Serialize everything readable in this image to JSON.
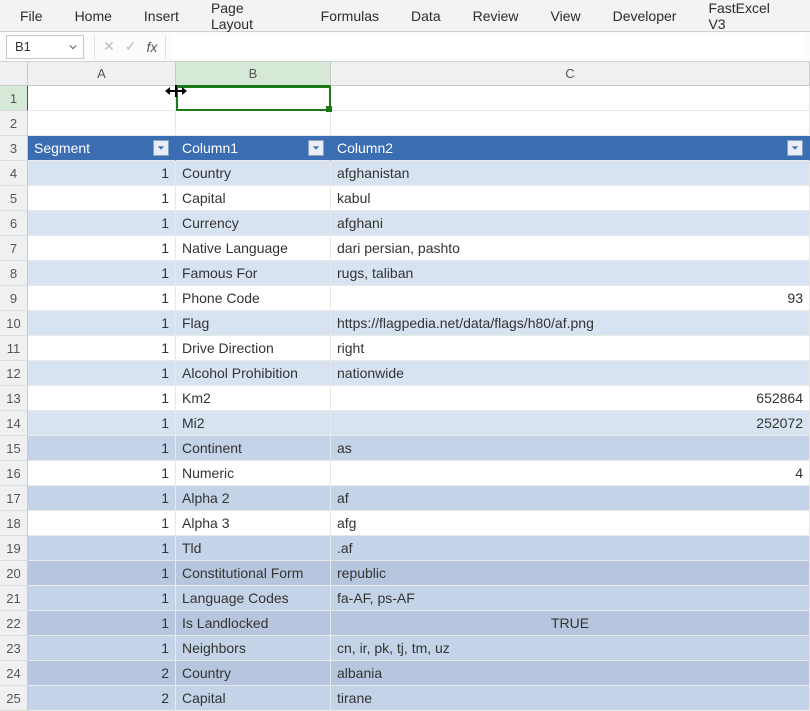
{
  "ribbon": {
    "tabs": [
      "File",
      "Home",
      "Insert",
      "Page Layout",
      "Formulas",
      "Data",
      "Review",
      "View",
      "Developer",
      "FastExcel V3"
    ]
  },
  "formula_bar": {
    "name_box": "B1",
    "cancel": "✕",
    "confirm": "✓",
    "fx": "fx",
    "value": ""
  },
  "columns": [
    "A",
    "B",
    "C"
  ],
  "active_cell": "B1",
  "table": {
    "headers": {
      "a": "Segment",
      "b": "Column1",
      "c": "Column2"
    },
    "rows": [
      {
        "a": "1",
        "b": "Country",
        "c": "afghanistan",
        "ca": "left"
      },
      {
        "a": "1",
        "b": "Capital",
        "c": "kabul",
        "ca": "left"
      },
      {
        "a": "1",
        "b": "Currency",
        "c": "afghani",
        "ca": "left"
      },
      {
        "a": "1",
        "b": "Native Language",
        "c": "dari persian, pashto",
        "ca": "left"
      },
      {
        "a": "1",
        "b": "Famous For",
        "c": "rugs, taliban",
        "ca": "left"
      },
      {
        "a": "1",
        "b": "Phone Code",
        "c": "93",
        "ca": "num"
      },
      {
        "a": "1",
        "b": "Flag",
        "c": "https://flagpedia.net/data/flags/h80/af.png",
        "ca": "left"
      },
      {
        "a": "1",
        "b": "Drive Direction",
        "c": "right",
        "ca": "left"
      },
      {
        "a": "1",
        "b": "Alcohol Prohibition",
        "c": "nationwide",
        "ca": "left"
      },
      {
        "a": "1",
        "b": "Km2",
        "c": "652864",
        "ca": "num"
      },
      {
        "a": "1",
        "b": "Mi2",
        "c": "252072",
        "ca": "num"
      },
      {
        "a": "1",
        "b": "Continent",
        "c": "as",
        "ca": "left"
      },
      {
        "a": "1",
        "b": "Numeric",
        "c": "4",
        "ca": "num"
      },
      {
        "a": "1",
        "b": "Alpha 2",
        "c": "af",
        "ca": "left"
      },
      {
        "a": "1",
        "b": "Alpha 3",
        "c": "afg",
        "ca": "left"
      },
      {
        "a": "1",
        "b": "Tld",
        "c": ".af",
        "ca": "left"
      },
      {
        "a": "1",
        "b": "Constitutional Form",
        "c": "republic",
        "ca": "left"
      },
      {
        "a": "1",
        "b": "Language Codes",
        "c": "fa-AF, ps-AF",
        "ca": "left"
      },
      {
        "a": "1",
        "b": "Is Landlocked",
        "c": "TRUE",
        "ca": "center"
      },
      {
        "a": "1",
        "b": "Neighbors",
        "c": "cn, ir, pk, tj, tm, uz",
        "ca": "left"
      },
      {
        "a": "2",
        "b": "Country",
        "c": "albania",
        "ca": "left"
      },
      {
        "a": "2",
        "b": "Capital",
        "c": "tirane",
        "ca": "left"
      }
    ]
  },
  "bands": [
    "",
    "",
    "thead",
    "band1",
    "band2",
    "band1",
    "band2",
    "band1",
    "band2",
    "band1",
    "band2",
    "band1",
    "band2",
    "band1",
    "band3",
    "band2",
    "band3",
    "band2",
    "band3",
    "band4",
    "band3",
    "band4",
    "band3",
    "band4",
    "band3"
  ]
}
